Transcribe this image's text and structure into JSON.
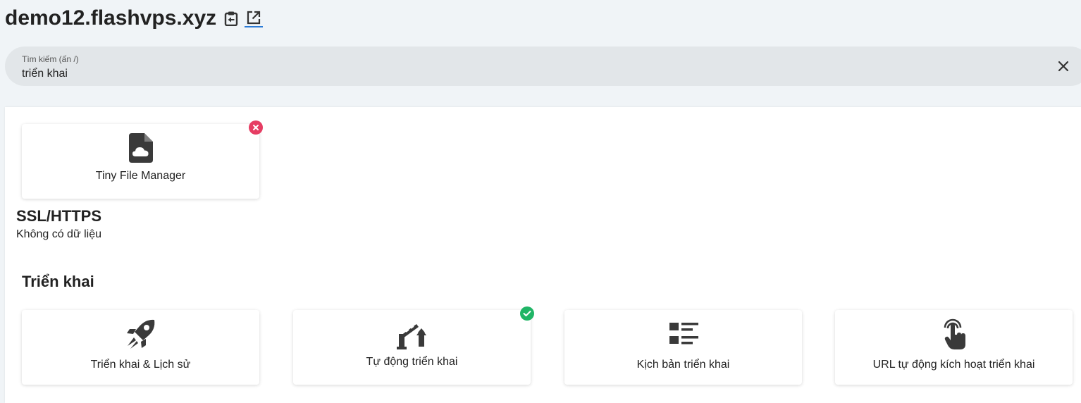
{
  "header": {
    "title": "demo12.flashvps.xyz",
    "icons": [
      "clipboard-icon",
      "external-link-icon"
    ]
  },
  "search": {
    "label": "Tìm kiếm (ấn /)",
    "value": "triển khai"
  },
  "results": {
    "top_card": {
      "label": "Tiny File Manager",
      "icon": "file-cloud-icon",
      "status": "error"
    },
    "ssl": {
      "title": "SSL/HTTPS",
      "empty_text": "Không có dữ liệu"
    },
    "deploy": {
      "title": "Triển khai",
      "cards": [
        {
          "label": "Triển khai & Lịch sử",
          "icon": "rocket-icon"
        },
        {
          "label": "Tự động triển khai",
          "icon": "barrier-up-icon",
          "status": "enabled"
        },
        {
          "label": "Kịch bản triển khai",
          "icon": "list-icon"
        },
        {
          "label": "URL tự động kích hoạt triển khai",
          "icon": "touch-icon"
        }
      ]
    }
  },
  "colors": {
    "accent": "#2b7bd6",
    "error_badge": "#e63d63",
    "ok_badge": "#20b566",
    "background": "#f0f4f7"
  }
}
